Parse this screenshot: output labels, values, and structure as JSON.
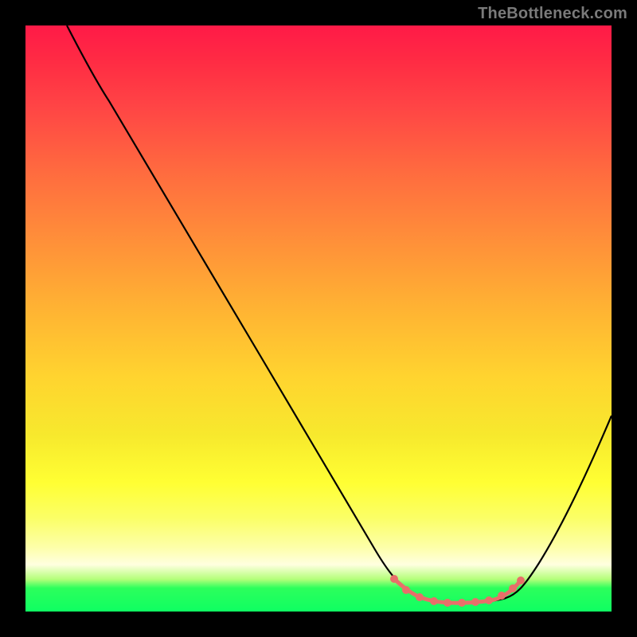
{
  "watermark": "TheBottleneck.com",
  "chart_data": {
    "type": "line",
    "title": "",
    "xlabel": "",
    "ylabel": "",
    "xlim": [
      0,
      100
    ],
    "ylim": [
      0,
      100
    ],
    "background": {
      "type": "vertical-gradient",
      "stops": [
        {
          "pos": 0,
          "color": "#ff1a47"
        },
        {
          "pos": 25,
          "color": "#ff6b3f"
        },
        {
          "pos": 48,
          "color": "#ffb233"
        },
        {
          "pos": 70,
          "color": "#f7e92d"
        },
        {
          "pos": 89,
          "color": "#fdffa8"
        },
        {
          "pos": 96,
          "color": "#2cff5c"
        },
        {
          "pos": 100,
          "color": "#0fff62"
        }
      ]
    },
    "series": [
      {
        "name": "bottleneck-curve",
        "color": "#000000",
        "points": [
          {
            "x": 7,
            "y": 100
          },
          {
            "x": 14,
            "y": 89
          },
          {
            "x": 20,
            "y": 79
          },
          {
            "x": 30,
            "y": 62
          },
          {
            "x": 40,
            "y": 45
          },
          {
            "x": 50,
            "y": 28
          },
          {
            "x": 58,
            "y": 14
          },
          {
            "x": 63,
            "y": 6
          },
          {
            "x": 68,
            "y": 2.5
          },
          {
            "x": 72,
            "y": 1.7
          },
          {
            "x": 76,
            "y": 1.6
          },
          {
            "x": 80,
            "y": 1.7
          },
          {
            "x": 84,
            "y": 3
          },
          {
            "x": 88,
            "y": 8
          },
          {
            "x": 92,
            "y": 15
          },
          {
            "x": 96,
            "y": 24
          },
          {
            "x": 100,
            "y": 34
          }
        ]
      },
      {
        "name": "optimum-band",
        "color": "#e86f6a",
        "points": [
          {
            "x": 63,
            "y": 5
          },
          {
            "x": 65,
            "y": 4
          },
          {
            "x": 68,
            "y": 2.5
          },
          {
            "x": 72,
            "y": 1.7
          },
          {
            "x": 76,
            "y": 1.6
          },
          {
            "x": 80,
            "y": 2
          },
          {
            "x": 83,
            "y": 3.8
          },
          {
            "x": 84,
            "y": 5
          }
        ]
      }
    ]
  }
}
